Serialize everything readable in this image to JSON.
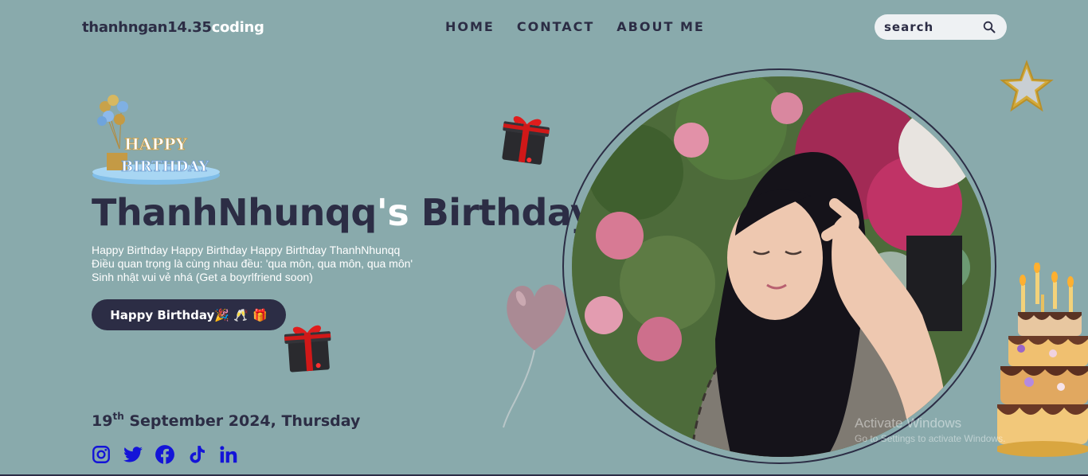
{
  "header": {
    "logo_main": "thanhngan14.35",
    "logo_accent": "coding",
    "nav": [
      "HOME",
      "CONTACT",
      "ABOUT ME"
    ],
    "search_placeholder": "search",
    "search_icon": "magnifier-icon"
  },
  "hero": {
    "badge_line1": "HAPPY",
    "badge_line2": "BIRTHDAY",
    "title_name": "ThanhNhunqq",
    "title_apos": "'s",
    "title_rest": " Birthday",
    "lines": [
      "Happy Birthday Happy Birthday Happy Birthday ThanhNhunqq",
      "Điều quan trọng là cùng nhau đều: 'qua môn, qua môn, qua môn'",
      "Sinh nhật vui vẻ nhá (Get a boyrlfriend soon)"
    ],
    "cta_label": "Happy Birthday🎉 🥂 🎁",
    "date_day": "19",
    "date_suffix": "th",
    "date_rest": " September 2024, Thursday"
  },
  "socials": [
    "instagram-icon",
    "twitter-icon",
    "facebook-icon",
    "tiktok-icon",
    "linkedin-icon"
  ],
  "watermark": {
    "line1": "Activate Windows",
    "line2": "Go to Settings to activate Windows."
  },
  "colors": {
    "background": "#89aaac",
    "dark": "#2c2d45",
    "accent_white": "#ffffff",
    "social_blue": "#1414d8"
  }
}
